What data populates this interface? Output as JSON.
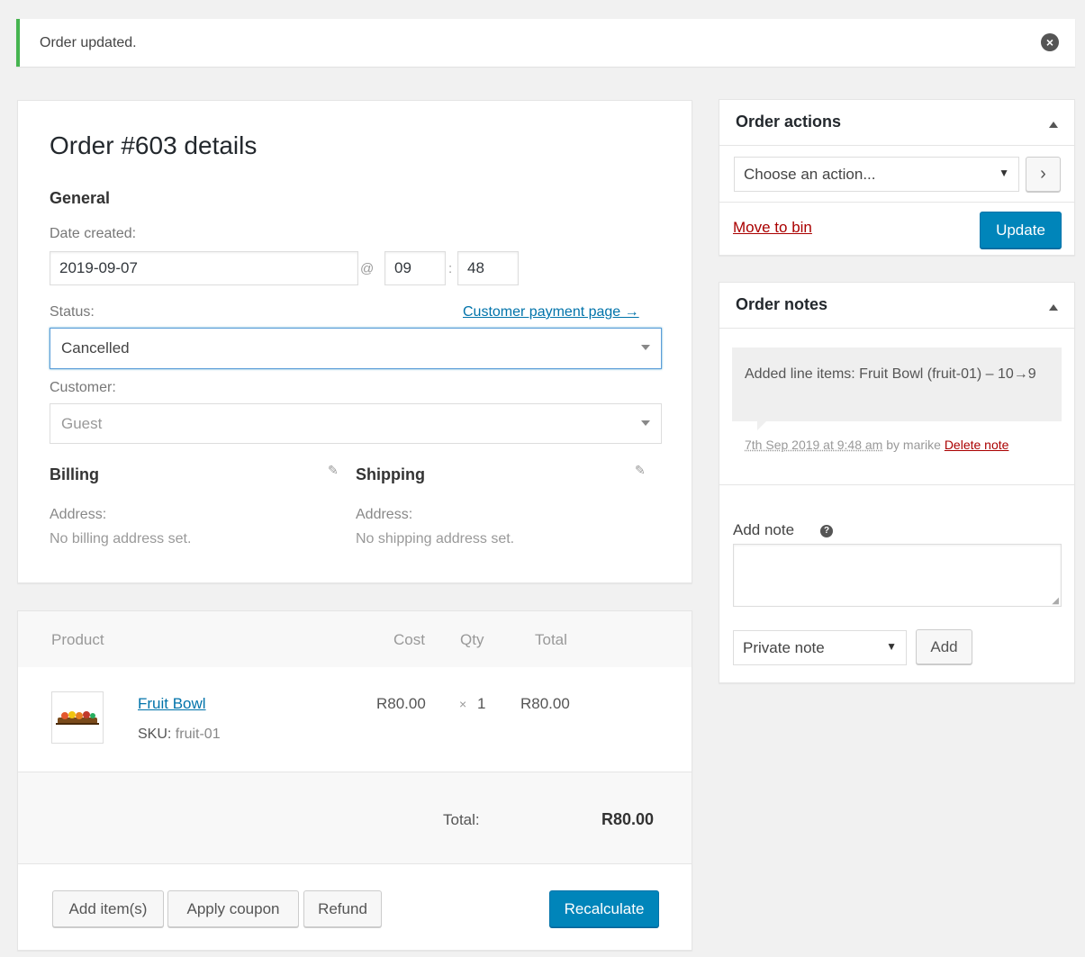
{
  "notice": {
    "text": "Order updated."
  },
  "order": {
    "title": "Order #603 details",
    "general_heading": "General",
    "date_label": "Date created:",
    "date": "2019-09-07",
    "at_sign": "@",
    "hour": "09",
    "colon": ":",
    "minute": "48",
    "status_label": "Status:",
    "payment_link": "Customer payment page →",
    "status_value": "Cancelled",
    "customer_label": "Customer:",
    "customer_value": "Guest",
    "billing": {
      "heading": "Billing",
      "address_label": "Address:",
      "address_value": "No billing address set."
    },
    "shipping": {
      "heading": "Shipping",
      "address_label": "Address:",
      "address_value": "No shipping address set."
    }
  },
  "items": {
    "headers": {
      "product": "Product",
      "cost": "Cost",
      "qty": "Qty",
      "total": "Total"
    },
    "rows": [
      {
        "name": "Fruit Bowl",
        "sku_label": "SKU:",
        "sku": "fruit-01",
        "cost": "R80.00",
        "qty_times": "×",
        "qty": "1",
        "total": "R80.00"
      }
    ],
    "total_label": "Total:",
    "total_value": "R80.00",
    "buttons": {
      "add_items": "Add item(s)",
      "apply_coupon": "Apply coupon",
      "refund": "Refund",
      "recalculate": "Recalculate"
    }
  },
  "order_actions": {
    "title": "Order actions",
    "select_placeholder": "Choose an action...",
    "go_glyph": "›",
    "move_to_bin": "Move to bin",
    "update": "Update"
  },
  "order_notes": {
    "title": "Order notes",
    "note_text": "Added line items: Fruit Bowl (fruit-01) – 10→9",
    "note_date": "7th Sep 2019 at 9:48 am",
    "note_by": " by marike ",
    "delete_note": "Delete note",
    "add_note_label": "Add note",
    "help_glyph": "?",
    "note_type": "Private note",
    "add_button": "Add"
  },
  "colors": {
    "accent": "#0085ba",
    "link": "#0073aa",
    "danger": "#a00",
    "success": "#46b450"
  }
}
